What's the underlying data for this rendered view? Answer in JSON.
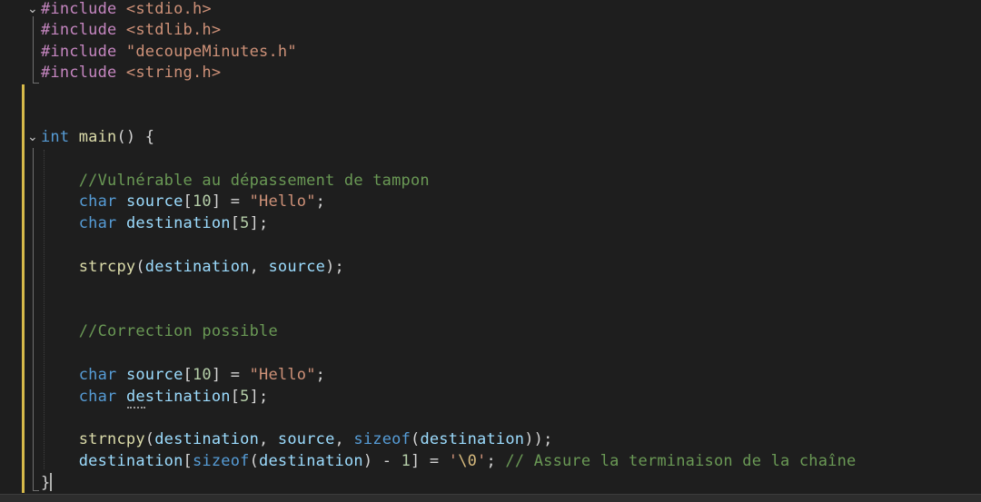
{
  "editor": {
    "language": "C",
    "colors": {
      "background": "#1e1e1e",
      "keyword": "#569cd6",
      "preprocessor": "#c586c0",
      "string": "#ce9178",
      "function": "#dcdcaa",
      "variable": "#9cdcfe",
      "number": "#b5cea8",
      "comment": "#6a9955",
      "modified_gutter": "#d7ba4a"
    },
    "lines": [
      {
        "tokens": [
          {
            "t": "pre",
            "v": "#include "
          },
          {
            "t": "str",
            "v": "<stdio.h>"
          }
        ]
      },
      {
        "tokens": [
          {
            "t": "pre",
            "v": "#include "
          },
          {
            "t": "str",
            "v": "<stdlib.h>"
          }
        ]
      },
      {
        "tokens": [
          {
            "t": "pre",
            "v": "#include "
          },
          {
            "t": "str",
            "v": "\"decoupeMinutes.h\""
          }
        ]
      },
      {
        "tokens": [
          {
            "t": "pre",
            "v": "#include "
          },
          {
            "t": "str",
            "v": "<string.h>"
          }
        ]
      },
      {
        "tokens": []
      },
      {
        "tokens": []
      },
      {
        "tokens": [
          {
            "t": "kw",
            "v": "int"
          },
          {
            "t": "txt",
            "v": " "
          },
          {
            "t": "fn",
            "v": "main"
          },
          {
            "t": "txt",
            "v": "() {"
          }
        ]
      },
      {
        "tokens": []
      },
      {
        "tokens": [
          {
            "t": "txt",
            "v": "    "
          },
          {
            "t": "com",
            "v": "//Vulnérable au dépassement de tampon"
          }
        ]
      },
      {
        "tokens": [
          {
            "t": "txt",
            "v": "    "
          },
          {
            "t": "kw",
            "v": "char"
          },
          {
            "t": "txt",
            "v": " "
          },
          {
            "t": "var",
            "v": "source"
          },
          {
            "t": "txt",
            "v": "["
          },
          {
            "t": "num",
            "v": "10"
          },
          {
            "t": "txt",
            "v": "] = "
          },
          {
            "t": "str",
            "v": "\"Hello\""
          },
          {
            "t": "txt",
            "v": ";"
          }
        ]
      },
      {
        "tokens": [
          {
            "t": "txt",
            "v": "    "
          },
          {
            "t": "kw",
            "v": "char"
          },
          {
            "t": "txt",
            "v": " "
          },
          {
            "t": "var",
            "v": "destination"
          },
          {
            "t": "txt",
            "v": "["
          },
          {
            "t": "num",
            "v": "5"
          },
          {
            "t": "txt",
            "v": "];"
          }
        ]
      },
      {
        "tokens": []
      },
      {
        "tokens": [
          {
            "t": "txt",
            "v": "    "
          },
          {
            "t": "fn",
            "v": "strcpy"
          },
          {
            "t": "txt",
            "v": "("
          },
          {
            "t": "var",
            "v": "destination"
          },
          {
            "t": "txt",
            "v": ", "
          },
          {
            "t": "var",
            "v": "source"
          },
          {
            "t": "txt",
            "v": ");"
          }
        ]
      },
      {
        "tokens": []
      },
      {
        "tokens": []
      },
      {
        "tokens": [
          {
            "t": "txt",
            "v": "    "
          },
          {
            "t": "com",
            "v": "//Correction possible"
          }
        ]
      },
      {
        "tokens": []
      },
      {
        "tokens": [
          {
            "t": "txt",
            "v": "    "
          },
          {
            "t": "kw",
            "v": "char"
          },
          {
            "t": "txt",
            "v": " "
          },
          {
            "t": "var",
            "v": "source"
          },
          {
            "t": "txt",
            "v": "["
          },
          {
            "t": "num",
            "v": "10"
          },
          {
            "t": "txt",
            "v": "] = "
          },
          {
            "t": "str",
            "v": "\"Hello\""
          },
          {
            "t": "txt",
            "v": ";"
          }
        ]
      },
      {
        "tokens": [
          {
            "t": "txt",
            "v": "    "
          },
          {
            "t": "kw",
            "v": "char"
          },
          {
            "t": "txt",
            "v": " "
          },
          {
            "t": "var",
            "v": "destination"
          },
          {
            "t": "txt",
            "v": "["
          },
          {
            "t": "num",
            "v": "5"
          },
          {
            "t": "txt",
            "v": "];"
          }
        ]
      },
      {
        "tokens": []
      },
      {
        "tokens": [
          {
            "t": "txt",
            "v": "    "
          },
          {
            "t": "fn",
            "v": "strncpy"
          },
          {
            "t": "txt",
            "v": "("
          },
          {
            "t": "var",
            "v": "destination"
          },
          {
            "t": "txt",
            "v": ", "
          },
          {
            "t": "var",
            "v": "source"
          },
          {
            "t": "txt",
            "v": ", "
          },
          {
            "t": "kw",
            "v": "sizeof"
          },
          {
            "t": "txt",
            "v": "("
          },
          {
            "t": "var",
            "v": "destination"
          },
          {
            "t": "txt",
            "v": "));"
          }
        ]
      },
      {
        "tokens": [
          {
            "t": "txt",
            "v": "    "
          },
          {
            "t": "var",
            "v": "destination"
          },
          {
            "t": "txt",
            "v": "["
          },
          {
            "t": "kw",
            "v": "sizeof"
          },
          {
            "t": "txt",
            "v": "("
          },
          {
            "t": "var",
            "v": "destination"
          },
          {
            "t": "txt",
            "v": ") - "
          },
          {
            "t": "num",
            "v": "1"
          },
          {
            "t": "txt",
            "v": "] = "
          },
          {
            "t": "str",
            "v": "'"
          },
          {
            "t": "esc",
            "v": "\\0"
          },
          {
            "t": "str",
            "v": "'"
          },
          {
            "t": "txt",
            "v": "; "
          },
          {
            "t": "com",
            "v": "// Assure la terminaison de la chaîne"
          }
        ]
      },
      {
        "tokens": [
          {
            "t": "txt",
            "v": "}"
          }
        ]
      }
    ]
  }
}
